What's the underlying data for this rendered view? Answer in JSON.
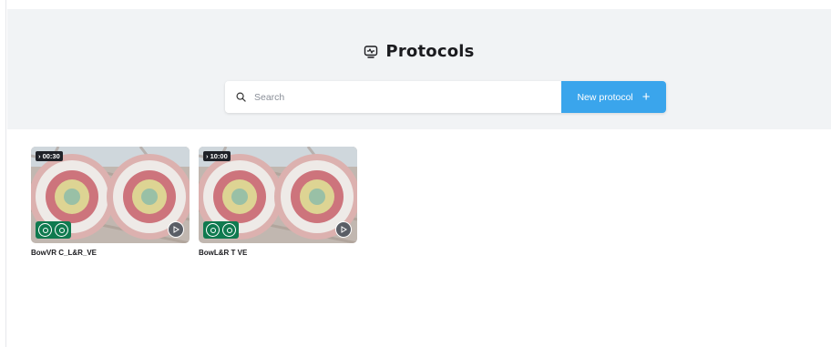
{
  "header": {
    "title": "Protocols",
    "title_icon": "monitor-pulse-icon"
  },
  "search": {
    "placeholder": "Search",
    "value": "",
    "icon": "search-icon"
  },
  "new_button": {
    "label": "New protocol",
    "icon": "plus-icon"
  },
  "protocols": [
    {
      "name": "BowVR C_L&R_VE",
      "duration": "› 00:30"
    },
    {
      "name": "BowL&R T VE",
      "duration": "› 10:00"
    }
  ],
  "colors": {
    "header_bg": "#f1f3f5",
    "accent": "#3aa5ec",
    "badge_green": "#0f7a4f"
  }
}
